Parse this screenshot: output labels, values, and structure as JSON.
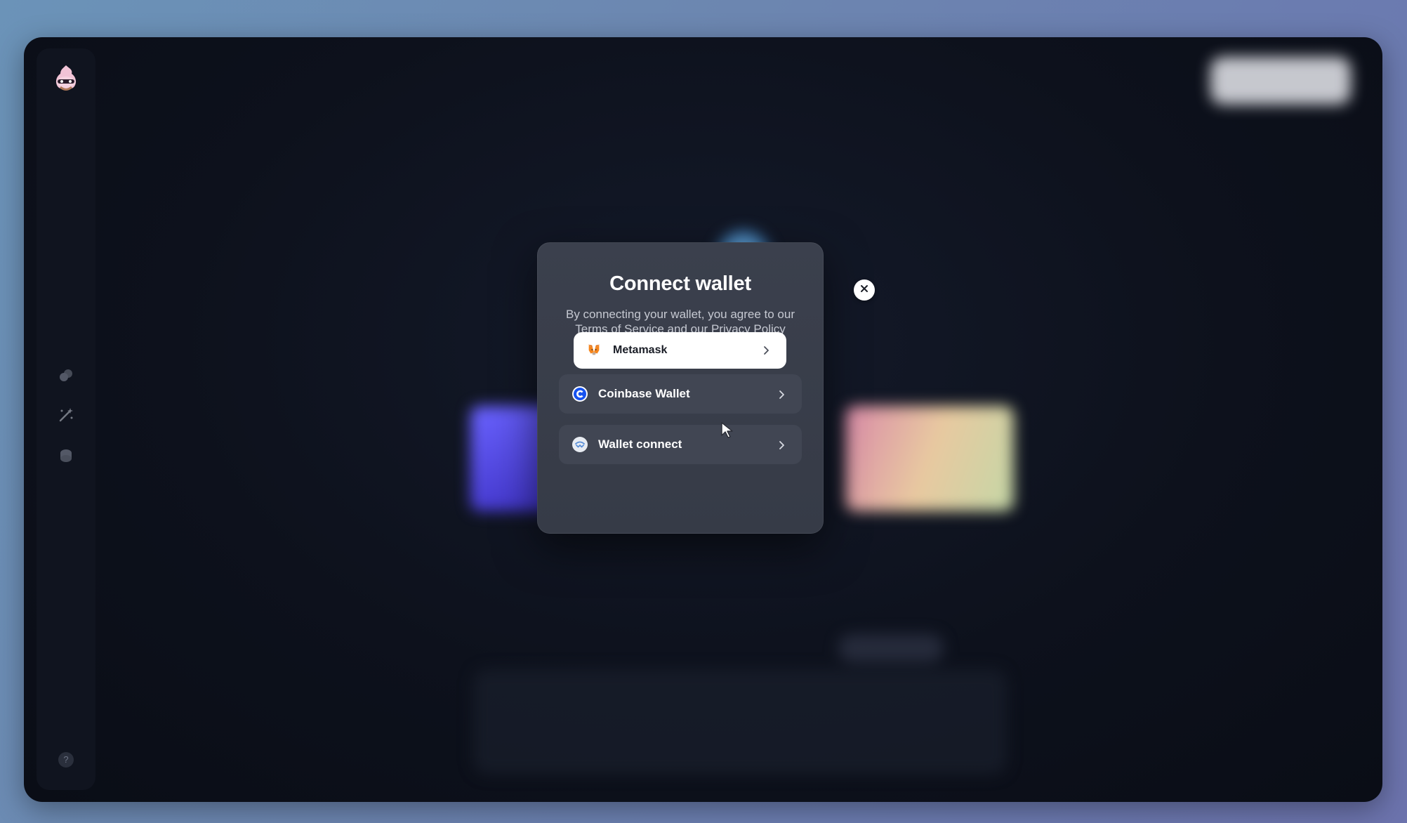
{
  "modal": {
    "title": "Connect wallet",
    "subtitle": "By connecting your wallet, you agree to our Terms of Service and our Privacy Policy",
    "options": [
      {
        "label": "Metamask",
        "icon": "metamask-fox-icon"
      },
      {
        "label": "Coinbase Wallet",
        "icon": "coinbase-icon"
      },
      {
        "label": "Wallet connect",
        "icon": "walletconnect-icon"
      }
    ],
    "close_icon": "close-icon"
  },
  "sidebar": {
    "icons": [
      "logo-avatar-icon",
      "layers-icon",
      "magic-wand-icon",
      "coins-icon"
    ],
    "help_label": "?"
  },
  "colors": {
    "accent_coinbase": "#1652f0",
    "modal_bg": "#3b404d",
    "page_bg": "#0d111c"
  }
}
